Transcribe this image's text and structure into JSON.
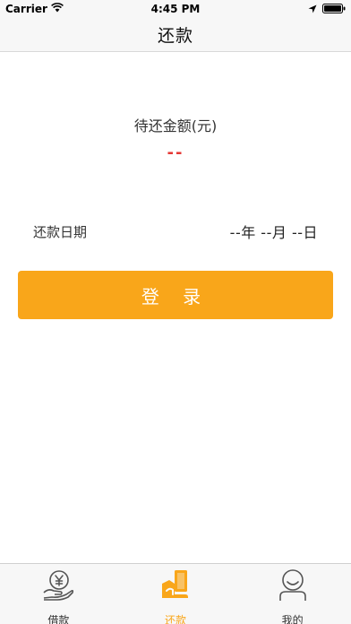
{
  "status_bar": {
    "carrier": "Carrier",
    "time": "4:45 PM"
  },
  "nav": {
    "title": "还款"
  },
  "amount": {
    "label": "待还金额(元)",
    "value": "--"
  },
  "due_date": {
    "label": "还款日期",
    "value": "--年 --月 --日"
  },
  "login_button": {
    "label": "登 录"
  },
  "tabbar": {
    "tabs": [
      {
        "label": "借款",
        "icon": "loan-yen-hand-icon",
        "active": false
      },
      {
        "label": "还款",
        "icon": "repay-hand-icon",
        "active": true
      },
      {
        "label": "我的",
        "icon": "user-profile-icon",
        "active": false
      }
    ]
  },
  "colors": {
    "accent": "#f9a61a",
    "amount_red": "#e53935",
    "bar_bg": "#f7f7f7"
  }
}
